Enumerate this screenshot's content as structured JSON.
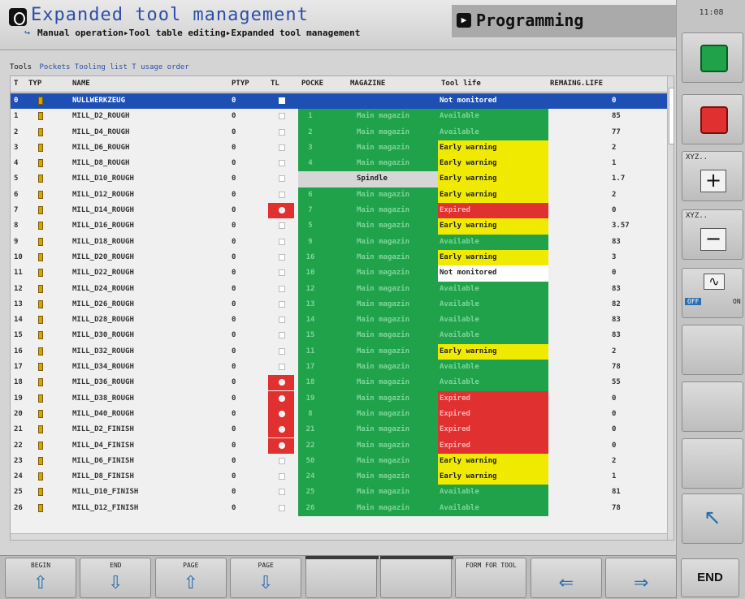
{
  "header": {
    "title": "Expanded tool management",
    "breadcrumb": "Manual operation▸Tool table editing▸Expanded tool management",
    "mode": "Programming",
    "clock": "11:08"
  },
  "tabs": {
    "active": "Tools",
    "rest": "Pockets Tooling list T usage order"
  },
  "columns": [
    "T",
    "TYP",
    "NAME",
    "PTYP",
    "TL",
    "POCKE",
    "MAGAZINE",
    "Tool life",
    "REMAING.LIFE"
  ],
  "rows": [
    {
      "t": "0",
      "name": "NULLWERKZEUG",
      "ptyp": "0",
      "pocket": "",
      "magazine": "",
      "life": "Not monitored",
      "remain": "0",
      "fill": "sel",
      "tl": "sel"
    },
    {
      "t": "1",
      "name": "MILL_D2_ROUGH",
      "ptyp": "0",
      "pocket": "1",
      "magazine": "Main magazin",
      "life": "Available",
      "remain": "85",
      "fill": "green",
      "tl": "off"
    },
    {
      "t": "2",
      "name": "MILL_D4_ROUGH",
      "ptyp": "0",
      "pocket": "2",
      "magazine": "Main magazin",
      "life": "Available",
      "remain": "77",
      "fill": "green",
      "tl": "off"
    },
    {
      "t": "3",
      "name": "MILL_D6_ROUGH",
      "ptyp": "0",
      "pocket": "3",
      "magazine": "Main magazin",
      "life": "Early warning",
      "remain": "2",
      "fill": "yellow",
      "tl": "off"
    },
    {
      "t": "4",
      "name": "MILL_D8_ROUGH",
      "ptyp": "0",
      "pocket": "4",
      "magazine": "Main magazin",
      "life": "Early warning",
      "remain": "1",
      "fill": "yellow",
      "tl": "off"
    },
    {
      "t": "5",
      "name": "MILL_D10_ROUGH",
      "ptyp": "0",
      "pocket": "",
      "magazine": "Spindle",
      "life": "Early warning",
      "remain": "1.7",
      "fill": "spindle",
      "tl": "off"
    },
    {
      "t": "6",
      "name": "MILL_D12_ROUGH",
      "ptyp": "0",
      "pocket": "6",
      "magazine": "Main magazin",
      "life": "Early warning",
      "remain": "2",
      "fill": "yellow",
      "tl": "off"
    },
    {
      "t": "7",
      "name": "MILL_D14_ROUGH",
      "ptyp": "0",
      "pocket": "7",
      "magazine": "Main magazin",
      "life": "Expired",
      "remain": "0",
      "fill": "red",
      "tl": "on"
    },
    {
      "t": "8",
      "name": "MILL_D16_ROUGH",
      "ptyp": "0",
      "pocket": "5",
      "magazine": "Main magazin",
      "life": "Early warning",
      "remain": "3.57",
      "fill": "yellow",
      "tl": "off"
    },
    {
      "t": "9",
      "name": "MILL_D18_ROUGH",
      "ptyp": "0",
      "pocket": "9",
      "magazine": "Main magazin",
      "life": "Available",
      "remain": "83",
      "fill": "green",
      "tl": "off"
    },
    {
      "t": "10",
      "name": "MILL_D20_ROUGH",
      "ptyp": "0",
      "pocket": "16",
      "magazine": "Main magazin",
      "life": "Early warning",
      "remain": "3",
      "fill": "yellow",
      "tl": "off"
    },
    {
      "t": "11",
      "name": "MILL_D22_ROUGH",
      "ptyp": "0",
      "pocket": "10",
      "magazine": "Main magazin",
      "life": "Not monitored",
      "remain": "0",
      "fill": "white",
      "tl": "off"
    },
    {
      "t": "12",
      "name": "MILL_D24_ROUGH",
      "ptyp": "0",
      "pocket": "12",
      "magazine": "Main magazin",
      "life": "Available",
      "remain": "83",
      "fill": "green",
      "tl": "off"
    },
    {
      "t": "13",
      "name": "MILL_D26_ROUGH",
      "ptyp": "0",
      "pocket": "13",
      "magazine": "Main magazin",
      "life": "Available",
      "remain": "82",
      "fill": "green",
      "tl": "off"
    },
    {
      "t": "14",
      "name": "MILL_D28_ROUGH",
      "ptyp": "0",
      "pocket": "14",
      "magazine": "Main magazin",
      "life": "Available",
      "remain": "83",
      "fill": "green",
      "tl": "off"
    },
    {
      "t": "15",
      "name": "MILL_D30_ROUGH",
      "ptyp": "0",
      "pocket": "15",
      "magazine": "Main magazin",
      "life": "Available",
      "remain": "83",
      "fill": "green",
      "tl": "off"
    },
    {
      "t": "16",
      "name": "MILL_D32_ROUGH",
      "ptyp": "0",
      "pocket": "11",
      "magazine": "Main magazin",
      "life": "Early warning",
      "remain": "2",
      "fill": "yellow",
      "tl": "off"
    },
    {
      "t": "17",
      "name": "MILL_D34_ROUGH",
      "ptyp": "0",
      "pocket": "17",
      "magazine": "Main magazin",
      "life": "Available",
      "remain": "78",
      "fill": "green",
      "tl": "off"
    },
    {
      "t": "18",
      "name": "MILL_D36_ROUGH",
      "ptyp": "0",
      "pocket": "18",
      "magazine": "Main magazin",
      "life": "Available",
      "remain": "55",
      "fill": "green",
      "tl": "on"
    },
    {
      "t": "19",
      "name": "MILL_D38_ROUGH",
      "ptyp": "0",
      "pocket": "19",
      "magazine": "Main magazin",
      "life": "Expired",
      "remain": "0",
      "fill": "red",
      "tl": "on"
    },
    {
      "t": "20",
      "name": "MILL_D40_ROUGH",
      "ptyp": "0",
      "pocket": "8",
      "magazine": "Main magazin",
      "life": "Expired",
      "remain": "0",
      "fill": "red",
      "tl": "on"
    },
    {
      "t": "21",
      "name": "MILL_D2_FINISH",
      "ptyp": "0",
      "pocket": "21",
      "magazine": "Main magazin",
      "life": "Expired",
      "remain": "0",
      "fill": "red",
      "tl": "on"
    },
    {
      "t": "22",
      "name": "MILL_D4_FINISH",
      "ptyp": "0",
      "pocket": "22",
      "magazine": "Main magazin",
      "life": "Expired",
      "remain": "0",
      "fill": "red",
      "tl": "on"
    },
    {
      "t": "23",
      "name": "MILL_D6_FINISH",
      "ptyp": "0",
      "pocket": "50",
      "magazine": "Main magazin",
      "life": "Early warning",
      "remain": "2",
      "fill": "yellow",
      "tl": "off"
    },
    {
      "t": "24",
      "name": "MILL_D8_FINISH",
      "ptyp": "0",
      "pocket": "24",
      "magazine": "Main magazin",
      "life": "Early warning",
      "remain": "1",
      "fill": "yellow",
      "tl": "off"
    },
    {
      "t": "25",
      "name": "MILL_D10_FINISH",
      "ptyp": "0",
      "pocket": "25",
      "magazine": "Main magazin",
      "life": "Available",
      "remain": "81",
      "fill": "green",
      "tl": "off"
    },
    {
      "t": "26",
      "name": "MILL_D12_FINISH",
      "ptyp": "0",
      "pocket": "26",
      "magazine": "Main magazin",
      "life": "Available",
      "remain": "78",
      "fill": "green",
      "tl": "off"
    }
  ],
  "softkeys": [
    {
      "label": "BEGIN",
      "icon": "arrow-up-bar-icon"
    },
    {
      "label": "END",
      "icon": "arrow-down-bar-icon"
    },
    {
      "label": "PAGE",
      "icon": "arrow-up-icon"
    },
    {
      "label": "PAGE",
      "icon": "arrow-down-icon"
    },
    {
      "label": "",
      "icon": ""
    },
    {
      "label": "",
      "icon": ""
    },
    {
      "label": "FORM FOR TOOL",
      "icon": ""
    },
    {
      "label": "",
      "icon": "prev-document-icon"
    },
    {
      "label": "",
      "icon": "next-document-icon"
    }
  ],
  "end_key": "END",
  "side": {
    "xyz_plus": "XYZ..",
    "xyz_minus": "XYZ..",
    "off": "OFF",
    "on": "ON"
  },
  "colors": {
    "green": "#1fa24a",
    "yellow": "#f0ea00",
    "red": "#e03030",
    "selection": "#1d4fb4",
    "title": "#2b4fa6"
  }
}
